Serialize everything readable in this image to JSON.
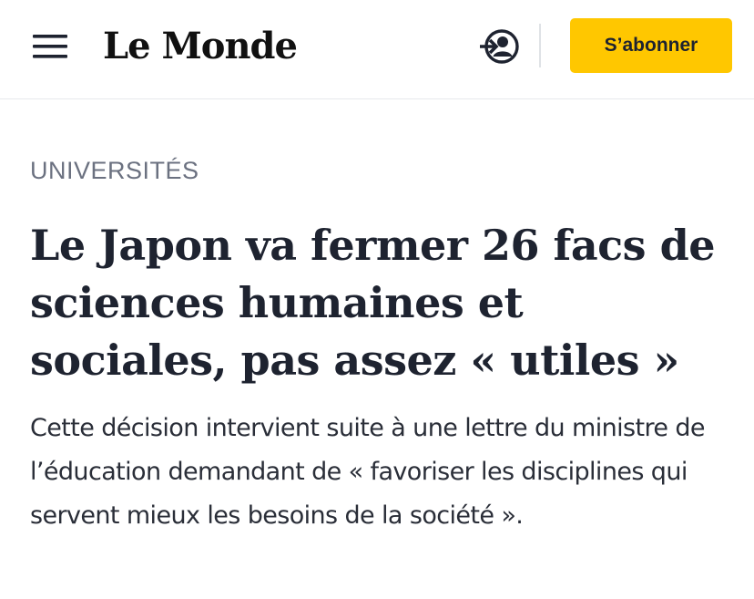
{
  "header": {
    "logo_text": "Le Monde",
    "subscribe_label": "S’abonner",
    "icons": {
      "menu": "hamburger-menu-icon",
      "login": "login-user-icon"
    }
  },
  "article": {
    "section": "UNIVERSITÉS",
    "headline": "Le Japon va fermer 26 facs de sciences humaines et sociales, pas assez « utiles »",
    "lead": "Cette décision intervient suite à une lettre du ministre de l’éducation demandant de « favoriser les disciplines qui servent mieux les besoins de la société »."
  },
  "colors": {
    "subscribe_bg": "#ffc700",
    "text": "#1e2330",
    "section_label": "#6b7180",
    "divider": "#e6e8ec"
  }
}
